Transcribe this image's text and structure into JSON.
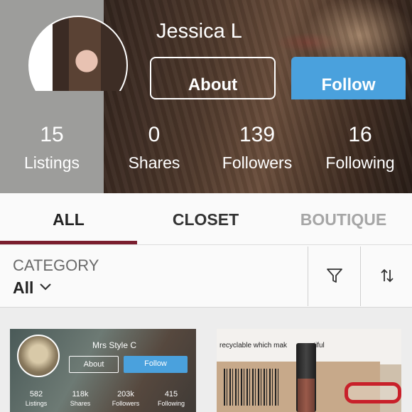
{
  "profile": {
    "name": "Jessica L",
    "about_label": "About",
    "follow_label": "Follow",
    "stats": [
      {
        "value": "15",
        "label": "Listings"
      },
      {
        "value": "0",
        "label": "Shares"
      },
      {
        "value": "139",
        "label": "Followers"
      },
      {
        "value": "16",
        "label": "Following"
      }
    ]
  },
  "tabs": [
    {
      "label": "ALL",
      "active": true
    },
    {
      "label": "CLOSET",
      "active": false
    },
    {
      "label": "BOUTIQUE",
      "active": false
    }
  ],
  "filter": {
    "category_label": "CATEGORY",
    "category_value": "All",
    "icons": [
      "filter-icon",
      "sort-icon",
      "chevron-down-icon"
    ]
  },
  "listings": [
    {
      "shop_name": "Mrs Style C",
      "about_label": "About",
      "follow_label": "Follow",
      "stats": [
        {
          "value": "582",
          "label": "Listings"
        },
        {
          "value": "118k",
          "label": "Shares"
        },
        {
          "value": "203k",
          "label": "Followers"
        },
        {
          "value": "415",
          "label": "Following"
        }
      ]
    },
    {
      "caption": "recyclable which mak",
      "caption_tail": "autiful"
    }
  ],
  "colors": {
    "follow_blue": "#4aa1dd",
    "tab_indicator": "#7a1e2e",
    "inactive_tab": "#a6a6a6"
  }
}
